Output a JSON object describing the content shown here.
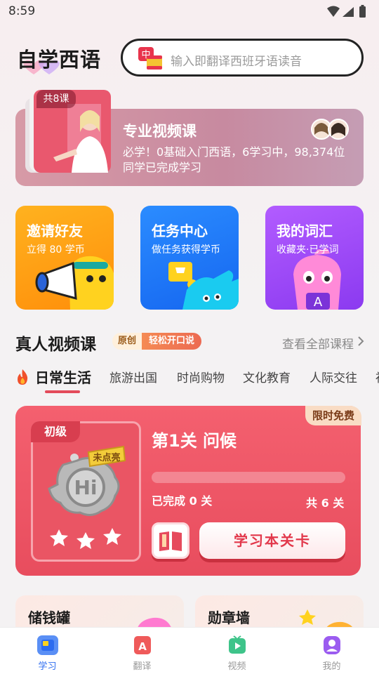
{
  "status_bar": {
    "time": "8:59"
  },
  "header": {
    "app_title": "自学西语",
    "search_placeholder": "输入即翻译西班牙语读音",
    "search_badge_char": "中"
  },
  "pro_course": {
    "count_label": "共8课",
    "title": "专业视频课",
    "description": "必学！0基础入门西语，6学习中，98,374位同学已完成学习"
  },
  "features": [
    {
      "title": "邀请好友",
      "subtitle": "立得 80 学币",
      "color": "#ff9c14"
    },
    {
      "title": "任务中心",
      "subtitle": "做任务获得学币",
      "color": "#1d74f5"
    },
    {
      "title": "我的词汇",
      "subtitle": "收藏夹·已学词",
      "color": "#9b47f5"
    }
  ],
  "video_section": {
    "title": "真人视频课",
    "tag_original": "原创",
    "tag_slogan": "轻松开口说",
    "view_all": "查看全部课程"
  },
  "category_tabs": [
    "日常生活",
    "旅游出国",
    "时尚购物",
    "文化教育",
    "人际交往",
    "社"
  ],
  "active_tab_index": 0,
  "lesson_card": {
    "free_badge": "限时免费",
    "level": "初级",
    "medal_status": "未点亮",
    "medal_text": "Hi",
    "title": "第1关 问候",
    "completed_text": "已完成 0 关",
    "total_text": "共 6 关",
    "progress": 0,
    "study_button": "学习本关卡",
    "accent": "#e84d5e"
  },
  "bottom_cards": [
    {
      "title": "储钱罐"
    },
    {
      "title": "勋章墙"
    }
  ],
  "tab_bar": {
    "items": [
      {
        "label": "学习",
        "icon": "study-icon"
      },
      {
        "label": "翻译",
        "icon": "translate-icon"
      },
      {
        "label": "视频",
        "icon": "video-icon"
      },
      {
        "label": "我的",
        "icon": "profile-icon"
      }
    ],
    "active_index": 0,
    "active_color": "#2d6cf0"
  }
}
